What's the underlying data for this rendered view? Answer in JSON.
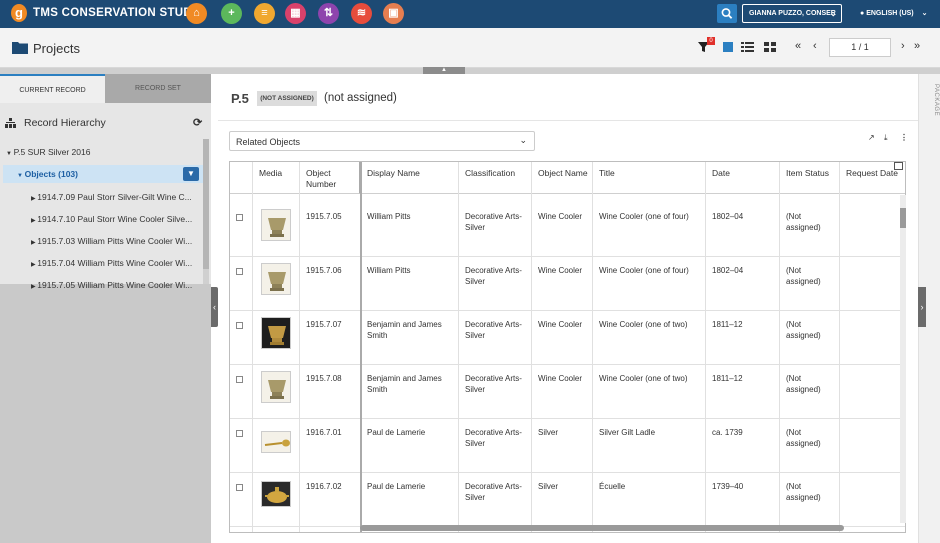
{
  "app": {
    "title": "TMS CONSERVATION STUDIO",
    "logo_letter": "g"
  },
  "topbar": {
    "buttons": [
      {
        "name": "home",
        "color": "#f08a24",
        "glyph": "⌂"
      },
      {
        "name": "add",
        "color": "#5cb85c",
        "glyph": "+"
      },
      {
        "name": "document",
        "color": "#f0a830",
        "glyph": "≡"
      },
      {
        "name": "media",
        "color": "#d9416b",
        "glyph": "▦"
      },
      {
        "name": "transfer",
        "color": "#8e44ad",
        "glyph": "⇅"
      },
      {
        "name": "layers",
        "color": "#e74c3c",
        "glyph": "≋"
      },
      {
        "name": "image",
        "color": "#e67e50",
        "glyph": "▣"
      }
    ],
    "user": "GIANNA PUZZO, CONSER",
    "language": "ENGLISH (US)"
  },
  "header": {
    "title": "Projects",
    "filter_badge": "0",
    "pager_value": "1 / 1"
  },
  "left_panel": {
    "tabs": {
      "current": "CURRENT RECORD",
      "set": "RECORD SET"
    },
    "hierarchy_title": "Record Hierarchy",
    "tree": {
      "root": "P.5 SUR Silver 2016",
      "group": "Objects (103)",
      "items": [
        "1914.7.09 Paul Storr Silver-Gilt Wine C...",
        "1914.7.10 Paul Storr Wine Cooler Silve...",
        "1915.7.03 William Pitts Wine Cooler Wi...",
        "1915.7.04 William Pitts Wine Cooler Wi...",
        "1915.7.05 William Pitts Wine Cooler Wi..."
      ]
    }
  },
  "record": {
    "id": "P.5",
    "badge": "(NOT ASSIGNED)",
    "status": "(not assigned)"
  },
  "related": {
    "selected": "Related Objects"
  },
  "side_label": "PACKAGE",
  "table": {
    "columns": [
      "Media",
      "Object Number",
      "Display Name",
      "Classification",
      "Object Name",
      "Title",
      "Date",
      "Item Status",
      "Request Date"
    ],
    "rows": [
      {
        "number": "1915.7.05",
        "display": "William Pitts",
        "classification": "Decorative Arts-Silver",
        "object_name": "Wine Cooler",
        "title": "Wine Cooler (one of four)",
        "date": "1802–04",
        "status": "(Not assigned)",
        "thumb": "cooler"
      },
      {
        "number": "1915.7.06",
        "display": "William Pitts",
        "classification": "Decorative Arts-Silver",
        "object_name": "Wine Cooler",
        "title": "Wine Cooler (one of four)",
        "date": "1802–04",
        "status": "(Not assigned)",
        "thumb": "cooler"
      },
      {
        "number": "1915.7.07",
        "display": "Benjamin and James Smith",
        "classification": "Decorative Arts-Silver",
        "object_name": "Wine Cooler",
        "title": "Wine Cooler (one of two)",
        "date": "1811–12",
        "status": "(Not assigned)",
        "thumb": "cooler-dark"
      },
      {
        "number": "1915.7.08",
        "display": "Benjamin and James Smith",
        "classification": "Decorative Arts-Silver",
        "object_name": "Wine Cooler",
        "title": "Wine Cooler (one of two)",
        "date": "1811–12",
        "status": "(Not assigned)",
        "thumb": "cooler"
      },
      {
        "number": "1916.7.01",
        "display": "Paul de Lamerie",
        "classification": "Decorative Arts-Silver",
        "object_name": "Silver",
        "title": "Silver Gilt Ladle",
        "date": "ca. 1739",
        "status": "(Not assigned)",
        "thumb": "ladle"
      },
      {
        "number": "1916.7.02",
        "display": "Paul de Lamerie",
        "classification": "Decorative Arts-Silver",
        "object_name": "Silver",
        "title": "Écuelle",
        "date": "1739–40",
        "status": "(Not assigned)",
        "thumb": "ecuelle"
      }
    ]
  }
}
